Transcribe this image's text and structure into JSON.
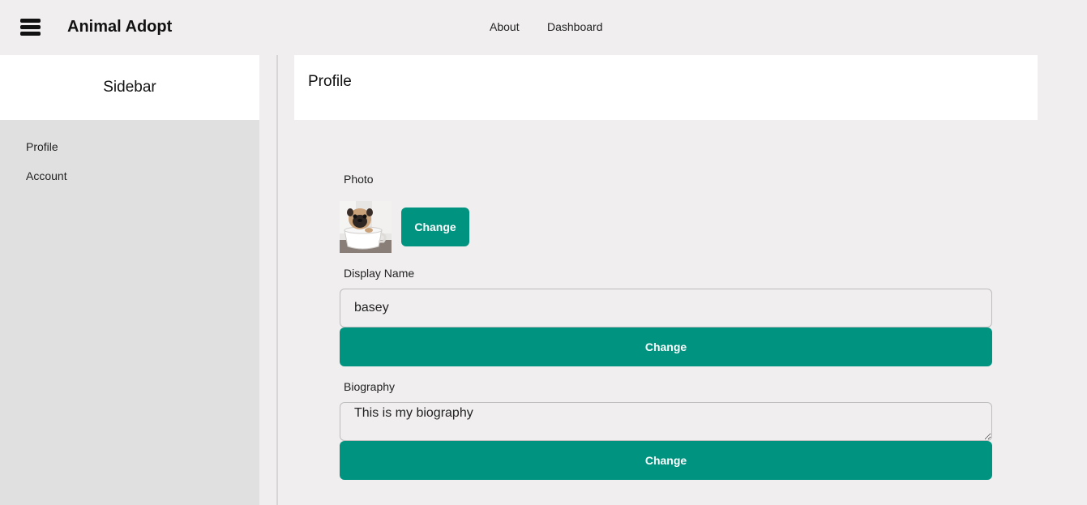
{
  "header": {
    "brand": "Animal Adopt",
    "nav": {
      "about": "About",
      "dashboard": "Dashboard"
    }
  },
  "sidebar": {
    "title": "Sidebar",
    "items": [
      {
        "label": "Profile"
      },
      {
        "label": "Account"
      }
    ]
  },
  "main": {
    "title": "Profile",
    "photo": {
      "label": "Photo",
      "button": "Change"
    },
    "display_name": {
      "label": "Display Name",
      "value": "basey",
      "button": "Change"
    },
    "biography": {
      "label": "Biography",
      "value": "This is my biography",
      "button": "Change"
    }
  },
  "colors": {
    "accent": "#009380",
    "background": "#f0eeef",
    "sidebar": "#e0e0e0"
  }
}
